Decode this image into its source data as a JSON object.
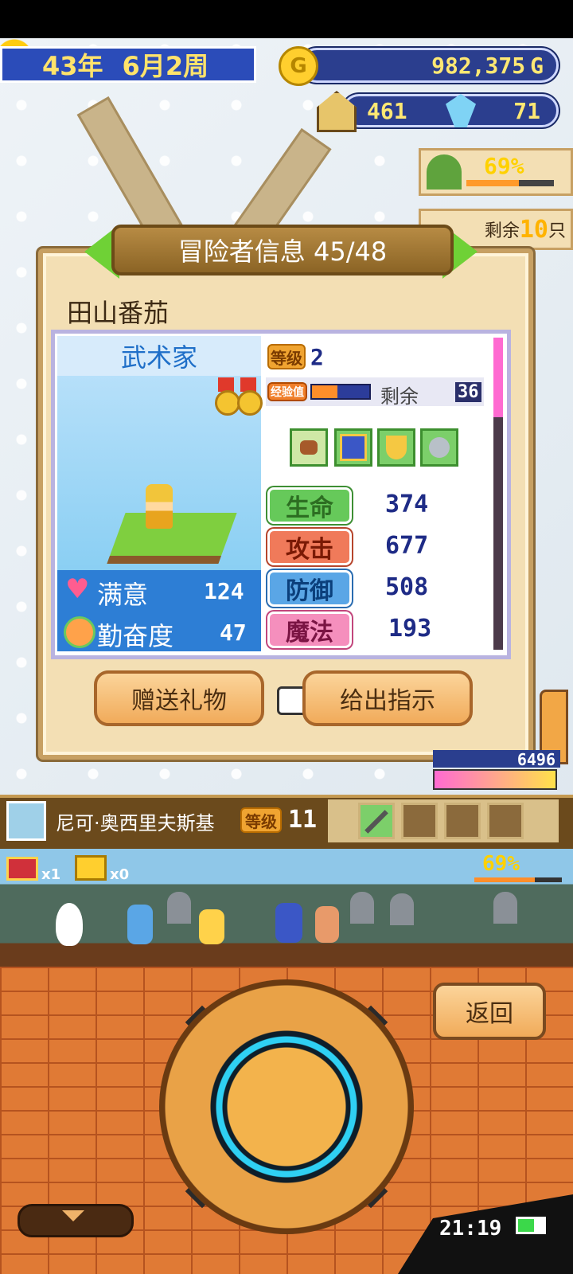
{
  "hud": {
    "year_label": "43年",
    "date_label": "6月2周",
    "gold": "982,375",
    "gold_unit": "G",
    "coin_symbol": "G",
    "houses": "461",
    "crystals": "71",
    "satisfaction_percent": "69%",
    "remaining_label": "剩余",
    "remaining_count": "10",
    "remaining_unit": "只",
    "side_value": "6496"
  },
  "dialog": {
    "title": "冒险者信息 45/48",
    "adventurer_name": "田山番茄",
    "job": "武术家",
    "level_badge": "等级",
    "level": "2",
    "exp_badge": "经验值",
    "exp_remaining_label": "剩余",
    "exp_remaining": "36",
    "exp_fill": 0.45,
    "satisfaction_label": "满意",
    "satisfaction_value": "124",
    "diligence_label": "勤奋度",
    "diligence_value": "47",
    "stats": [
      {
        "label": "生命",
        "value": "374"
      },
      {
        "label": "攻击",
        "value": "677"
      },
      {
        "label": "防御",
        "value": "508"
      },
      {
        "label": "魔法",
        "value": "193"
      }
    ],
    "gift_button": "赠送礼物",
    "instruct_button": "给出指示"
  },
  "info_bar": {
    "name": "尼可·奥西里夫斯基",
    "level_badge": "等级",
    "level": "11"
  },
  "battle": {
    "chest_red_count": "x1",
    "chest_gold_count": "x0",
    "progress": "69%"
  },
  "controls": {
    "back_button": "返回",
    "clock": "21:19"
  },
  "colors": {
    "accent": "#2b3e8e",
    "dialog_bg": "#f3dfb4",
    "job_panel": "#78c8f0"
  }
}
